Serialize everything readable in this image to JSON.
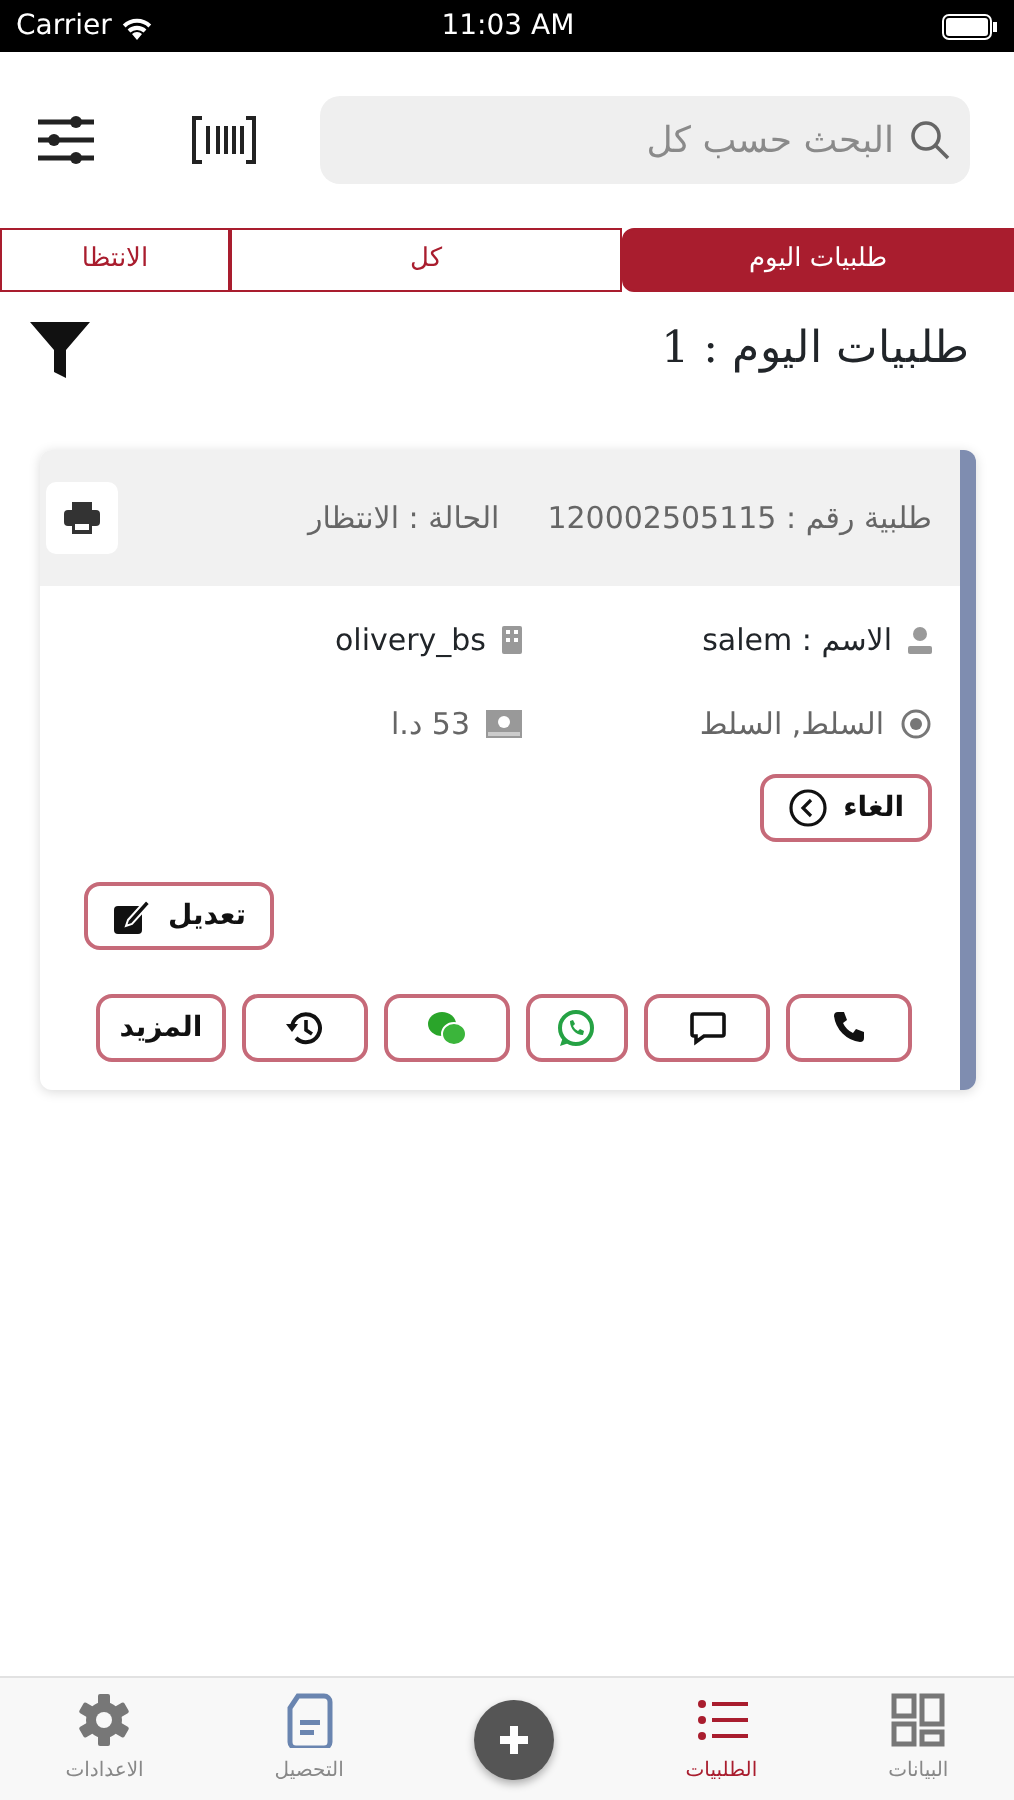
{
  "status_bar": {
    "carrier": "Carrier",
    "time": "11:03 AM"
  },
  "search": {
    "placeholder": "البحث حسب كل"
  },
  "tabs": [
    {
      "label": "طلبيات اليوم",
      "selected": true
    },
    {
      "label": "كل",
      "selected": false
    },
    {
      "label": "الانتظا",
      "selected": false
    }
  ],
  "heading": "طلبيات اليوم : 1",
  "order": {
    "number": "طلبية رقم : 120002505115",
    "status": "الحالة : الانتظار",
    "name": "الاسم : salem",
    "store": "olivery_bs",
    "address": "السلط, السلط",
    "amount": "53 د.ا",
    "cancel_button": "الغاء",
    "edit_button": "تعديل",
    "actions": [
      {
        "kind": "call"
      },
      {
        "kind": "sms"
      },
      {
        "kind": "whatsapp"
      },
      {
        "kind": "wechat"
      },
      {
        "kind": "history"
      },
      {
        "kind": "more",
        "label": "المزيد"
      }
    ]
  },
  "bottom_nav": [
    {
      "kind": "grid",
      "label": "البيانات",
      "selected": false
    },
    {
      "kind": "list",
      "label": "الطلبيات",
      "selected": true
    },
    {
      "kind": "add"
    },
    {
      "kind": "document",
      "label": "التحصيل",
      "selected": false
    },
    {
      "kind": "gear",
      "label": "الاعدادات",
      "selected": false
    }
  ]
}
